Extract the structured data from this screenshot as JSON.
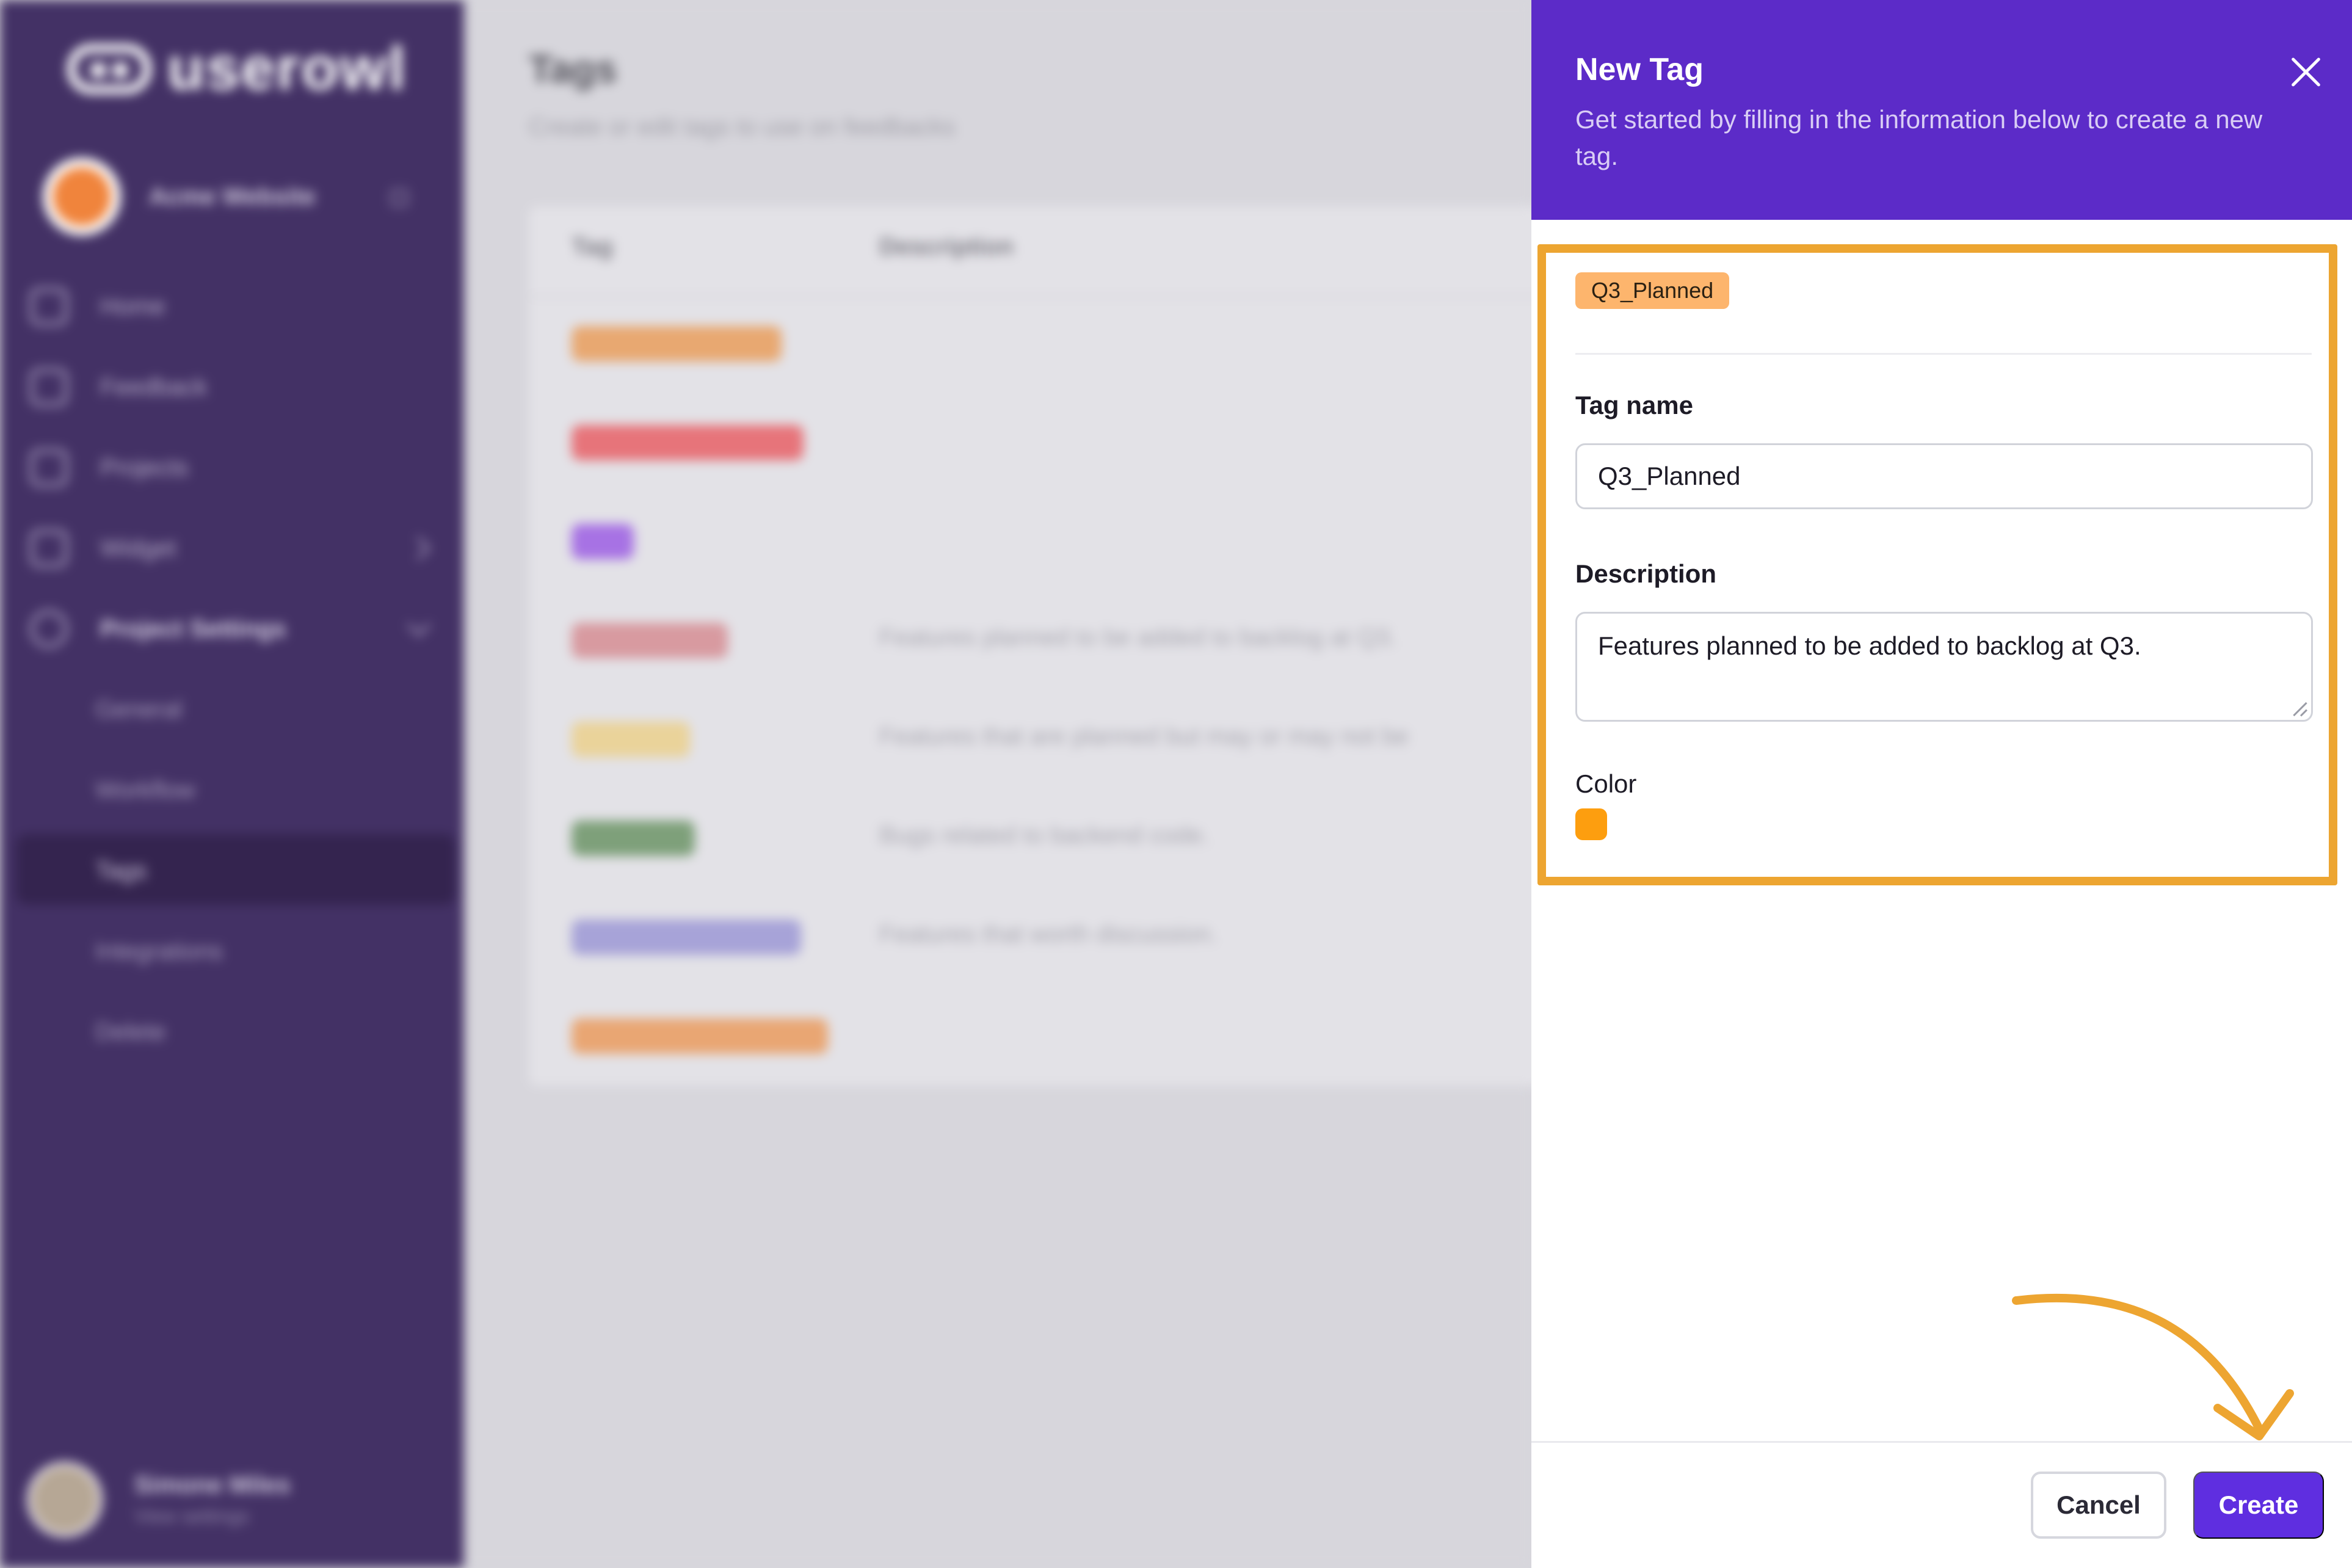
{
  "sidebar": {
    "logo_text": "userowl",
    "project_name": "Acme Website",
    "nav": [
      {
        "label": "Home"
      },
      {
        "label": "Feedback"
      },
      {
        "label": "Projects"
      },
      {
        "label": "Widget"
      },
      {
        "label": "Project Settings"
      }
    ],
    "sub_nav": [
      {
        "label": "General"
      },
      {
        "label": "Workflow"
      },
      {
        "label": "Tags"
      },
      {
        "label": "Integrations"
      },
      {
        "label": "Delete"
      }
    ],
    "user": {
      "name": "Simone Miles",
      "subtitle": "View settings"
    }
  },
  "main": {
    "title": "Tags",
    "subtitle": "Create or edit tags to use on feedbacks",
    "columns": [
      "Tag",
      "Description"
    ],
    "rows": [
      {
        "color": "#e8a871",
        "description": ""
      },
      {
        "color": "#e7747a",
        "description": ""
      },
      {
        "color": "#a772e4",
        "description": ""
      },
      {
        "color": "#d89aa0",
        "description": "Features planned to be added to backlog at Q3."
      },
      {
        "color": "#ead39a",
        "description": "Features that are planned but may or may not be"
      },
      {
        "color": "#7ea07a",
        "description": "Bugs related to backend code."
      },
      {
        "color": "#a7a3d8",
        "description": "Features that worth discussion."
      },
      {
        "color": "#e9a673",
        "description": ""
      }
    ]
  },
  "drawer": {
    "title": "New Tag",
    "description": "Get started by filling in the information below to create a new tag.",
    "preview_tag": "Q3_Planned",
    "tag_name_label": "Tag name",
    "tag_name_value": "Q3_Planned",
    "description_label": "Description",
    "description_value": "Features planned to be added to backlog at Q3.",
    "color_label": "Color",
    "color_value": "#fd9e0f",
    "cancel_label": "Cancel",
    "create_label": "Create"
  },
  "annotations": {
    "highlight_color": "#eda531"
  }
}
